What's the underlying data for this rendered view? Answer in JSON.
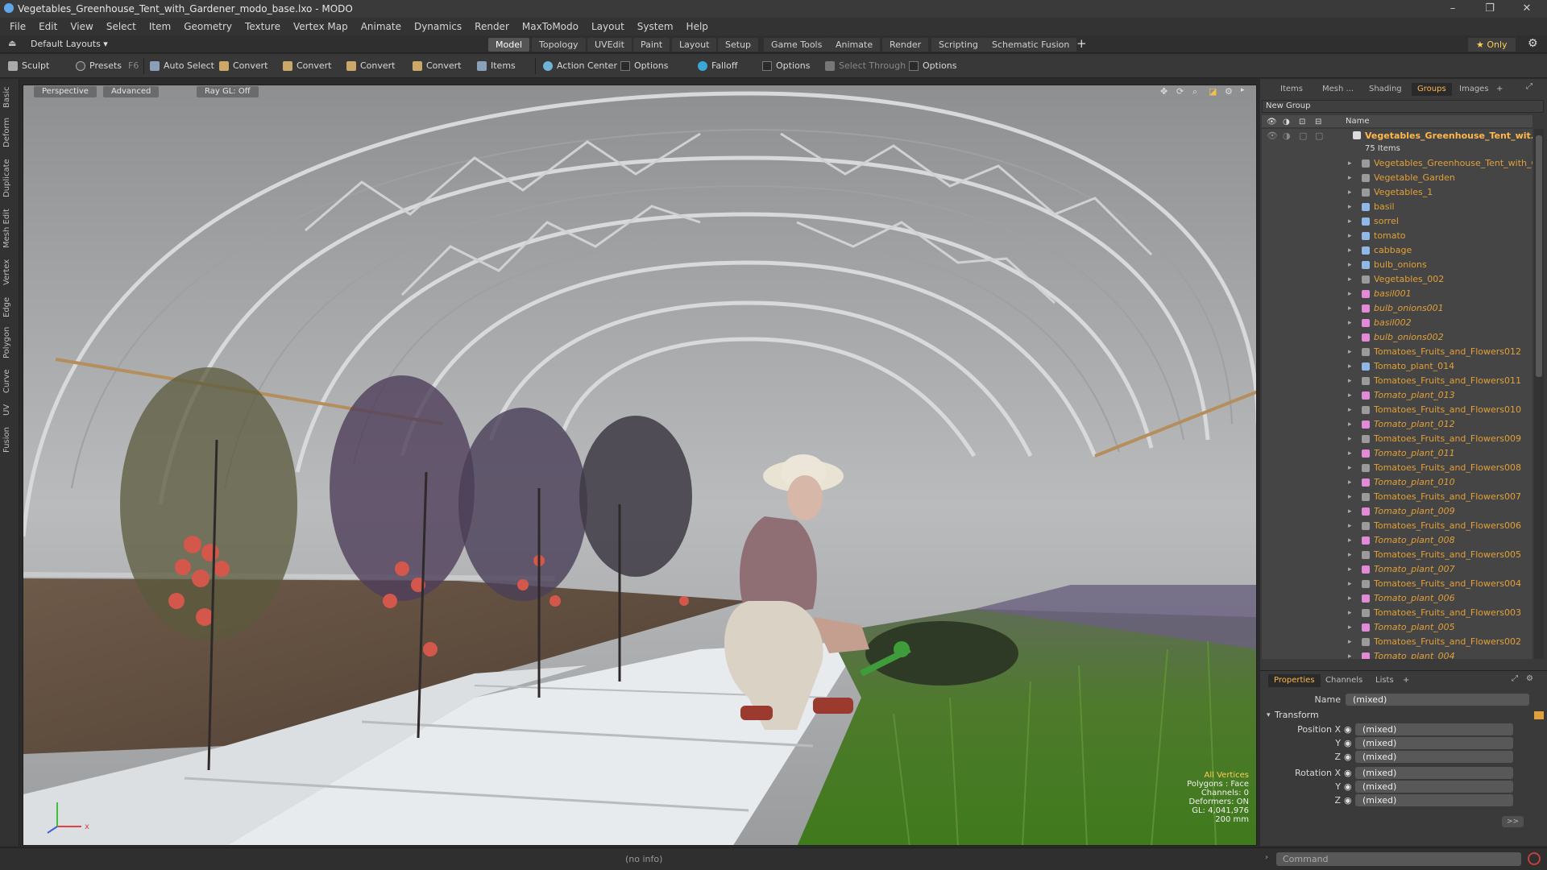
{
  "window": {
    "title": "Vegetables_Greenhouse_Tent_with_Gardener_modo_base.lxo - MODO",
    "controls": [
      "–",
      "❐",
      "✕"
    ]
  },
  "menu": [
    "File",
    "Edit",
    "View",
    "Select",
    "Item",
    "Geometry",
    "Texture",
    "Vertex Map",
    "Animate",
    "Dynamics",
    "Render",
    "MaxToModo",
    "Layout",
    "System",
    "Help"
  ],
  "layout_bar": {
    "layouts_label": "Default Layouts ▾",
    "tabs": [
      "Model",
      "Topology",
      "UVEdit",
      "Paint",
      "Layout",
      "Setup",
      "Game Tools",
      "Animate",
      "Render",
      "Scripting",
      "Schematic Fusion"
    ],
    "active_tab": "Model",
    "add": "+",
    "only_label": "★  Only"
  },
  "toolbar": {
    "sculpt": "Sculpt",
    "presets": "Presets",
    "presets_key": "F6",
    "auto_select": "Auto Select",
    "convert1": "Convert",
    "convert2": "Convert",
    "convert3": "Convert",
    "convert4": "Convert",
    "items": "Items",
    "action_center": "Action Center",
    "options1": "Options",
    "falloff": "Falloff",
    "options2": "Options",
    "select_through": "Select Through",
    "options3": "Options"
  },
  "left_tabs": [
    "Basic",
    "Deform",
    "Duplicate",
    "Mesh Edit",
    "Vertex",
    "Edge",
    "Polygon",
    "Curve",
    "UV",
    "Fusion"
  ],
  "viewport": {
    "view": "Perspective",
    "mode": "Advanced",
    "raygl": "Ray GL: Off",
    "info": {
      "selection": "All Vertices",
      "polygons": "Polygons : Face",
      "channels": "Channels: 0",
      "deformers": "Deformers: ON",
      "gl": "GL: 4,041,976",
      "scale": "200 mm"
    },
    "axis_x": "x"
  },
  "right_panel": {
    "tabs": [
      "Items",
      "Mesh ...",
      "Shading",
      "Groups",
      "Images",
      "+"
    ],
    "active_tab": "Groups",
    "new_group": "New Group",
    "column_name": "Name",
    "group_root": "Vegetables_Greenhouse_Tent_wit...",
    "group_count": "75 Items",
    "items": [
      {
        "name": "Vegetables_Greenhouse_Tent_with_G...",
        "kind": "locator",
        "italic": false
      },
      {
        "name": "Vegetable_Garden",
        "kind": "locator",
        "italic": false
      },
      {
        "name": "Vegetables_1",
        "kind": "locator",
        "italic": false
      },
      {
        "name": "basil",
        "kind": "mesh",
        "italic": false
      },
      {
        "name": "sorrel",
        "kind": "mesh",
        "italic": false
      },
      {
        "name": "tomato",
        "kind": "mesh",
        "italic": false
      },
      {
        "name": "cabbage",
        "kind": "mesh",
        "italic": false
      },
      {
        "name": "bulb_onions",
        "kind": "mesh",
        "italic": false
      },
      {
        "name": "Vegetables_002",
        "kind": "locator",
        "italic": false
      },
      {
        "name": "basil001",
        "kind": "instance",
        "italic": true
      },
      {
        "name": "bulb_onions001",
        "kind": "instance",
        "italic": true
      },
      {
        "name": "basil002",
        "kind": "instance",
        "italic": true
      },
      {
        "name": "bulb_onions002",
        "kind": "instance",
        "italic": true
      },
      {
        "name": "Tomatoes_Fruits_and_Flowers012",
        "kind": "locator",
        "italic": false
      },
      {
        "name": "Tomato_plant_014",
        "kind": "mesh",
        "italic": false
      },
      {
        "name": "Tomatoes_Fruits_and_Flowers011",
        "kind": "locator",
        "italic": false
      },
      {
        "name": "Tomato_plant_013",
        "kind": "instance",
        "italic": true
      },
      {
        "name": "Tomatoes_Fruits_and_Flowers010",
        "kind": "locator",
        "italic": false
      },
      {
        "name": "Tomato_plant_012",
        "kind": "instance",
        "italic": true
      },
      {
        "name": "Tomatoes_Fruits_and_Flowers009",
        "kind": "locator",
        "italic": false
      },
      {
        "name": "Tomato_plant_011",
        "kind": "instance",
        "italic": true
      },
      {
        "name": "Tomatoes_Fruits_and_Flowers008",
        "kind": "locator",
        "italic": false
      },
      {
        "name": "Tomato_plant_010",
        "kind": "instance",
        "italic": true
      },
      {
        "name": "Tomatoes_Fruits_and_Flowers007",
        "kind": "locator",
        "italic": false
      },
      {
        "name": "Tomato_plant_009",
        "kind": "instance",
        "italic": true
      },
      {
        "name": "Tomatoes_Fruits_and_Flowers006",
        "kind": "locator",
        "italic": false
      },
      {
        "name": "Tomato_plant_008",
        "kind": "instance",
        "italic": true
      },
      {
        "name": "Tomatoes_Fruits_and_Flowers005",
        "kind": "locator",
        "italic": false
      },
      {
        "name": "Tomato_plant_007",
        "kind": "instance",
        "italic": true
      },
      {
        "name": "Tomatoes_Fruits_and_Flowers004",
        "kind": "locator",
        "italic": false
      },
      {
        "name": "Tomato_plant_006",
        "kind": "instance",
        "italic": true
      },
      {
        "name": "Tomatoes_Fruits_and_Flowers003",
        "kind": "locator",
        "italic": false
      },
      {
        "name": "Tomato_plant_005",
        "kind": "instance",
        "italic": true
      },
      {
        "name": "Tomatoes_Fruits_and_Flowers002",
        "kind": "locator",
        "italic": false
      },
      {
        "name": "Tomato_plant_004",
        "kind": "instance",
        "italic": true
      }
    ]
  },
  "properties": {
    "tabs": [
      "Properties",
      "Channels",
      "Lists",
      "+"
    ],
    "active_tab": "Properties",
    "name_label": "Name",
    "name_value": "(mixed)",
    "section": "Transform",
    "position_label": "Position X",
    "rotation_label": "Rotation X",
    "y_label": "Y",
    "z_label": "Z",
    "mixed": "(mixed)",
    "more": ">>"
  },
  "status": {
    "info": "(no info)",
    "command_placeholder": "Command"
  },
  "colors": {
    "accent": "#ffb84d",
    "item_text": "#e0a03a",
    "mesh_icon": "#8fb8e6",
    "instance_icon": "#e08ad8",
    "locator_icon": "#9a9a9a"
  }
}
